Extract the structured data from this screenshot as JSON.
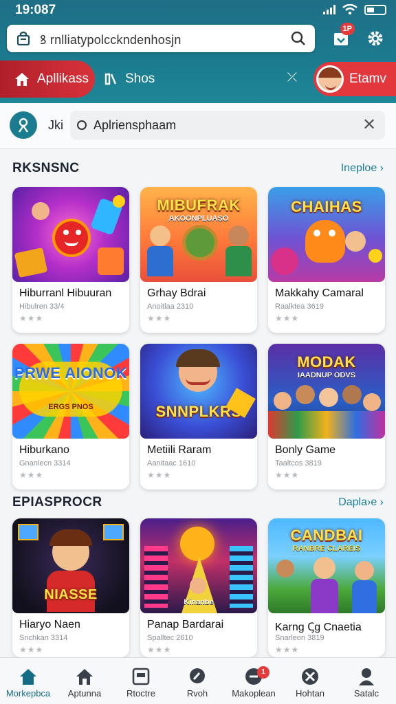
{
  "status_bar": {
    "time": "19:087"
  },
  "search": {
    "url_text": "ꝸ rnlliatypolcckndenhosjn",
    "notif_badge": "1P"
  },
  "tabs": {
    "home_label": "Apllikass",
    "shop_label": "Shos",
    "user_label": "Etamv"
  },
  "filter": {
    "label": "Jki",
    "chip_text": "Aplriensphaam"
  },
  "sections": [
    {
      "title": "RKSNSNC",
      "more": "Ineploe ›"
    },
    {
      "title": "EPIASPROCR",
      "more": "Dapla›e ›"
    }
  ],
  "cards": [
    {
      "name": "Hiburranl Hibuuran",
      "sub": "Hibulren 33/4",
      "stars": "★★★",
      "img_title": "",
      "img_sub": ""
    },
    {
      "name": "Grhay Bdrai",
      "sub": "Anoitlaa 2310",
      "stars": "★★★",
      "img_title": "MIBUFRAK",
      "img_sub": "AKOONPLUASO"
    },
    {
      "name": "Makkahy Camaral",
      "sub": "Raalktea 3619",
      "stars": "★★★",
      "img_title": "CHAIHAS",
      "img_sub": ""
    },
    {
      "name": "Hiburkano",
      "sub": "Gnanlecn 3314",
      "stars": "★★★",
      "img_title": "PRWE AIONOK",
      "img_sub": "ERGS PNOS"
    },
    {
      "name": "Metiili Raram",
      "sub": "Aanitaac 1610",
      "stars": "★★★",
      "img_title": "SNNPLKRS",
      "img_sub": ""
    },
    {
      "name": "Bonly Game",
      "sub": "Taaltcos 3819",
      "stars": "★★★",
      "img_title": "MODAK",
      "img_sub": "IAADNUP ODVS"
    },
    {
      "name": "Hiaryo Naen",
      "sub": "Snchkan 3314",
      "stars": "★★★",
      "img_title": "NIASSE",
      "img_sub": ""
    },
    {
      "name": "Panap Bardarai",
      "sub": "Spalltec 2610",
      "stars": "★★★",
      "img_title": "Kinanbe",
      "img_sub": ""
    },
    {
      "name": "Karng Ꞔg Cnaetia",
      "sub": "Snarleon 3819",
      "stars": "★★★",
      "img_title": "CANDBAI",
      "img_sub": "RANBRE CLAREIS"
    }
  ],
  "bottom_nav": [
    {
      "label": "Morkepbca",
      "icon": "home-icon"
    },
    {
      "label": "Aptunna",
      "icon": "house-icon"
    },
    {
      "label": "Rtoctre",
      "icon": "box-icon"
    },
    {
      "label": "Rvoh",
      "icon": "search-icon"
    },
    {
      "label": "Makoplean",
      "icon": "chat-icon",
      "badge": "1"
    },
    {
      "label": "Hohtan",
      "icon": "cancel-icon"
    },
    {
      "label": "Satalc",
      "icon": "user-icon"
    }
  ],
  "colors": {
    "brand": "#1b7b8f",
    "accent_red": "#d8323a",
    "link": "#1b7f95"
  }
}
